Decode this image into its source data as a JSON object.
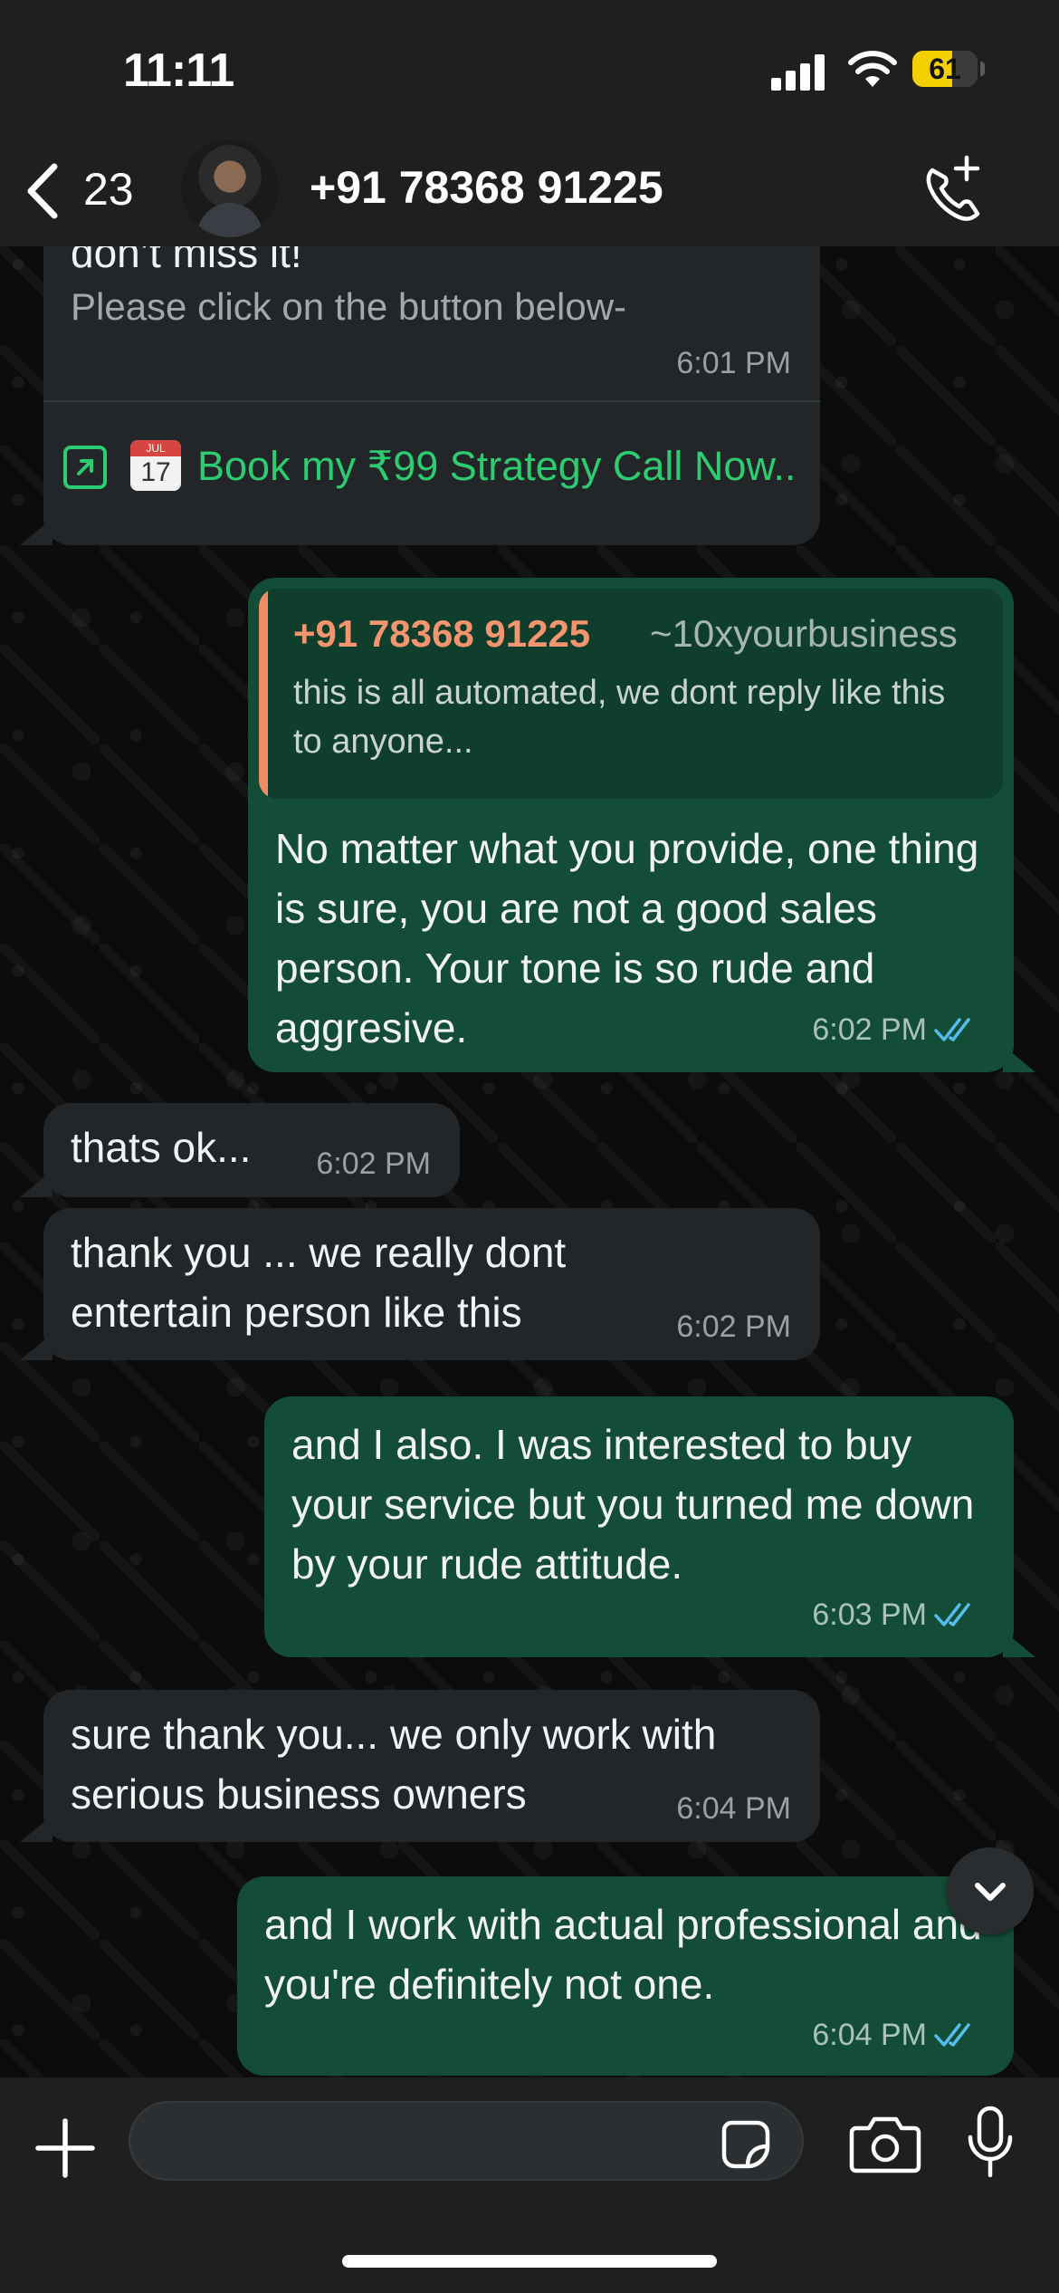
{
  "status_bar": {
    "time": "11:11",
    "battery_level": "61",
    "battery_fraction": 0.61
  },
  "header": {
    "unread_count": "23",
    "contact_name": "+91 78368 91225"
  },
  "messages": [
    {
      "direction": "incoming",
      "text_line1": "don’t miss it!",
      "text_line2": "Please click on the button below-",
      "time": "6:01 PM",
      "button_label": "Book my ₹99 Strategy Call Now..",
      "calendar_month": "JUL",
      "calendar_day": "17"
    },
    {
      "direction": "outgoing",
      "quote_sender": "+91 78368 91225",
      "quote_alias": "~10xyourbusiness",
      "quote_text": "this is all automated, we dont reply like this to anyone...",
      "text": "No matter what you provide, one thing is sure, you are not a good sales person. Your tone is so rude and aggresive.",
      "time": "6:02 PM",
      "status": "read"
    },
    {
      "direction": "incoming",
      "text": "thats ok...",
      "time": "6:02 PM"
    },
    {
      "direction": "incoming",
      "text": "thank you ... we really dont entertain person like this",
      "time": "6:02 PM"
    },
    {
      "direction": "outgoing",
      "text": "and I also. I was interested to buy your service but you turned me down by your rude attitude.",
      "time": "6:03 PM",
      "status": "read"
    },
    {
      "direction": "incoming",
      "text": "sure thank you... we only work with serious business owners",
      "time": "6:04 PM"
    },
    {
      "direction": "outgoing",
      "text": "and I work with actual professional and you're definitely not one.",
      "time": "6:04 PM",
      "status": "read"
    }
  ],
  "colors": {
    "incoming_bubble": "#232628",
    "outgoing_bubble": "#144d37",
    "link_green": "#2ecc71",
    "quote_accent": "#f08c63",
    "read_ticks": "#53bdeb",
    "battery_yellow": "#f5d000"
  },
  "icons": [
    "back-chevron-icon",
    "call-add-icon",
    "external-link-icon",
    "calendar-icon",
    "double-check-icon",
    "chevron-down-icon",
    "plus-icon",
    "sticker-icon",
    "camera-icon",
    "mic-icon",
    "signal-icon",
    "wifi-icon"
  ]
}
